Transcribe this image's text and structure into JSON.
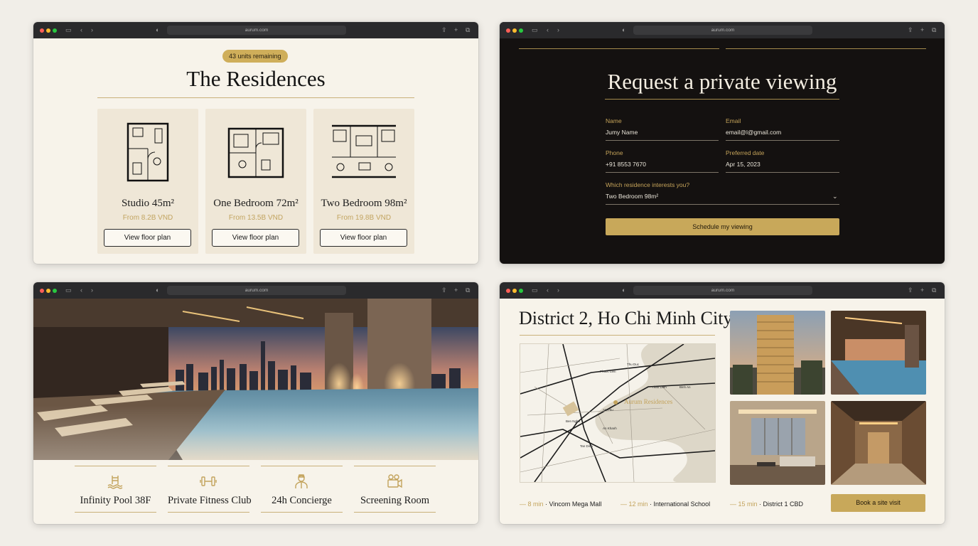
{
  "browser": {
    "url": "aurum.com"
  },
  "residences": {
    "badge": "43 units remaining",
    "title": "The Residences",
    "units": [
      {
        "name": "Studio 45m²",
        "price": "From 8.2B VND",
        "button": "View floor plan"
      },
      {
        "name": "One Bedroom 72m²",
        "price": "From 13.5B VND",
        "button": "View floor plan"
      },
      {
        "name": "Two Bedroom 98m²",
        "price": "From 19.8B VND",
        "button": "View floor plan"
      }
    ]
  },
  "viewing": {
    "title": "Request a private viewing",
    "fields": {
      "name": {
        "label": "Name",
        "value": "Jumy Name"
      },
      "email": {
        "label": "Email",
        "value": "email@l@gmail.com"
      },
      "phone": {
        "label": "Phone",
        "value": "+91 8553 7670"
      },
      "date": {
        "label": "Preferred date",
        "value": "Apr 15, 2023"
      },
      "residence": {
        "label": "Which residence interests you?",
        "value": "Two Bedroom 98m²"
      }
    },
    "submit": "Schedule my viewing"
  },
  "amenities": {
    "items": [
      {
        "name": "Infinity Pool 38F",
        "icon": "pool-icon"
      },
      {
        "name": "Private Fitness Club",
        "icon": "dumbbell-icon"
      },
      {
        "name": "24h Concierge",
        "icon": "concierge-icon"
      },
      {
        "name": "Screening Room",
        "icon": "projector-icon"
      }
    ]
  },
  "location": {
    "title": "District 2, Ho Chi Minh City",
    "map_pin": "Aurum Residences",
    "poi": [
      {
        "time": "8 min",
        "place": "Vincom Mega Mall"
      },
      {
        "time": "12 min",
        "place": "International School"
      },
      {
        "time": "15 min",
        "place": "District 1 CBD"
      }
    ],
    "cta": "Book a site visit"
  },
  "colors": {
    "gold": "#c8a85a",
    "cream": "#f7f3ea",
    "dark": "#141110"
  }
}
